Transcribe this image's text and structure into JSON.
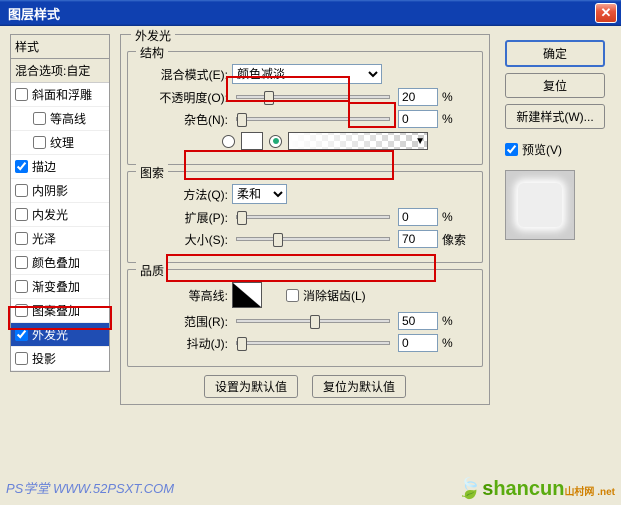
{
  "window": {
    "title": "图层样式"
  },
  "sidebar": {
    "header": "样式",
    "blend_opts": "混合选项:自定",
    "items": [
      {
        "label": "斜面和浮雕",
        "checked": false
      },
      {
        "label": "等高线",
        "checked": false,
        "indent": true
      },
      {
        "label": "纹理",
        "checked": false,
        "indent": true
      },
      {
        "label": "描边",
        "checked": true
      },
      {
        "label": "内阴影",
        "checked": false
      },
      {
        "label": "内发光",
        "checked": false
      },
      {
        "label": "光泽",
        "checked": false
      },
      {
        "label": "颜色叠加",
        "checked": false
      },
      {
        "label": "渐变叠加",
        "checked": false
      },
      {
        "label": "图案叠加",
        "checked": false
      },
      {
        "label": "外发光",
        "checked": true,
        "selected": true
      },
      {
        "label": "投影",
        "checked": false
      }
    ]
  },
  "main": {
    "outer_title": "外发光",
    "structure": {
      "title": "结构",
      "blend_mode_label": "混合模式(E):",
      "blend_mode_value": "颜色减淡",
      "opacity_label": "不透明度(O):",
      "opacity_value": "20",
      "opacity_unit": "%",
      "noise_label": "杂色(N):",
      "noise_value": "0",
      "noise_unit": "%"
    },
    "elements": {
      "title": "图索",
      "technique_label": "方法(Q):",
      "technique_value": "柔和",
      "spread_label": "扩展(P):",
      "spread_value": "0",
      "spread_unit": "%",
      "size_label": "大小(S):",
      "size_value": "70",
      "size_unit": "像索"
    },
    "quality": {
      "title": "品质",
      "contour_label": "等高线:",
      "antialias_label": "消除锯齿(L)",
      "antialias_checked": false,
      "range_label": "范围(R):",
      "range_value": "50",
      "range_unit": "%",
      "jitter_label": "抖动(J):",
      "jitter_value": "0",
      "jitter_unit": "%"
    },
    "defaults": {
      "set_default": "设置为默认值",
      "reset_default": "复位为默认值"
    }
  },
  "right": {
    "ok": "确定",
    "cancel": "复位",
    "new_style": "新建样式(W)...",
    "preview_label": "预览(V)",
    "preview_checked": true
  },
  "watermarks": {
    "ps": "PS学堂  WWW.52PSXT.COM",
    "sc_s": "s",
    "sc_rest": "hancun",
    "sc_small": "山村网 .net"
  }
}
